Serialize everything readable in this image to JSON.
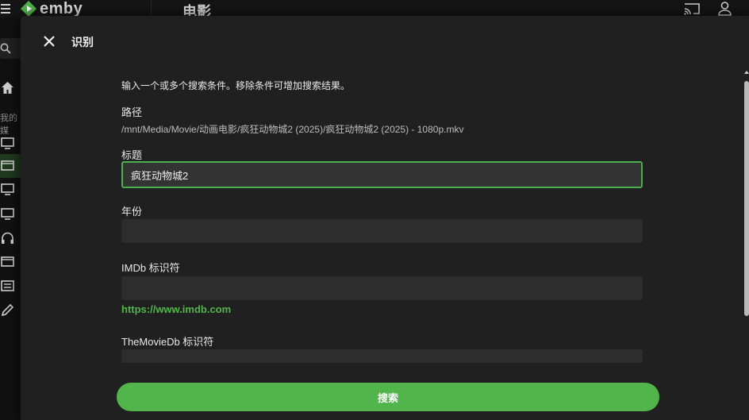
{
  "app": {
    "brand": "emby",
    "page_heading": "电影",
    "sidebar_section_label": "我的媒"
  },
  "dialog": {
    "title": "识别",
    "intro": "输入一个或多个搜索条件。移除条件可增加搜索结果。",
    "path": {
      "label": "路径",
      "value": "/mnt/Media/Movie/动画电影/疯狂动物城2 (2025)/疯狂动物城2 (2025) - 1080p.mkv"
    },
    "title_field": {
      "label": "标题",
      "value": "疯狂动物城2"
    },
    "year_field": {
      "label": "年份",
      "value": ""
    },
    "imdb_field": {
      "label": "IMDb 标识符",
      "value": "",
      "link": "https://www.imdb.com"
    },
    "tmdb_field": {
      "label": "TheMovieDb 标识符",
      "value": ""
    },
    "search_button": "搜索"
  },
  "colors": {
    "accent": "#52b54b",
    "dialog_bg": "#202020",
    "field_bg": "#2d2d2d"
  }
}
